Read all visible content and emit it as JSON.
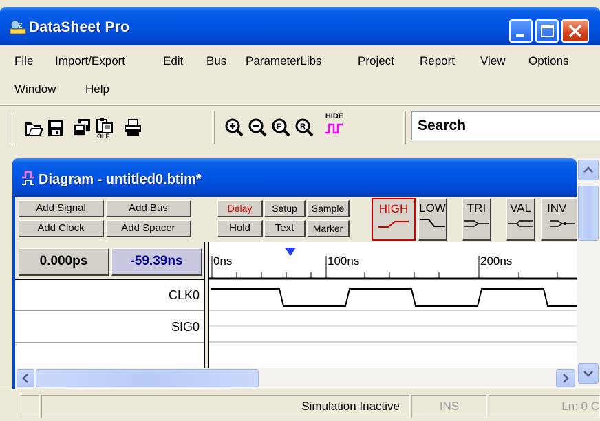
{
  "app": {
    "title": "DataSheet Pro"
  },
  "menu": {
    "items": [
      "File",
      "Import/Export",
      "Edit",
      "Bus",
      "ParameterLibs",
      "Project",
      "Report",
      "View",
      "Options",
      "Window",
      "Help"
    ]
  },
  "toolbar": {
    "hide_label": "HIDE",
    "search_value": "Search",
    "icons": [
      "open-folder-icon",
      "save-disk-icon",
      "copy-icon",
      "ole-paste-icon",
      "print-icon",
      "zoom-in-icon",
      "zoom-out-icon",
      "zoom-full-icon",
      "zoom-range-icon",
      "hide-waveform-icon"
    ]
  },
  "diagram": {
    "title": "Diagram - untitled0.btim*",
    "buttons": {
      "add_signal": "Add Signal",
      "add_bus": "Add Bus",
      "add_clock": "Add Clock",
      "add_spacer": "Add Spacer",
      "delay": "Delay",
      "setup": "Setup",
      "sample": "Sample",
      "hold": "Hold",
      "text": "Text",
      "marker": "Marker"
    },
    "waveform_buttons": [
      "HIGH",
      "LOW",
      "TRI",
      "VAL",
      "INV"
    ],
    "time_left": "0.000ps",
    "time_delta": "-59.39ns",
    "ruler": {
      "labels": [
        "0ns",
        "100ns",
        "200ns"
      ]
    },
    "signals": [
      {
        "name": "CLK0"
      },
      {
        "name": "SIG0"
      }
    ]
  },
  "status": {
    "sim": "Simulation Inactive",
    "ins": "INS",
    "pos": "Ln: 0  C"
  },
  "colors": {
    "titlebar": "#0054e3",
    "active_button": "#cc0000",
    "marker": "#0000ff"
  }
}
